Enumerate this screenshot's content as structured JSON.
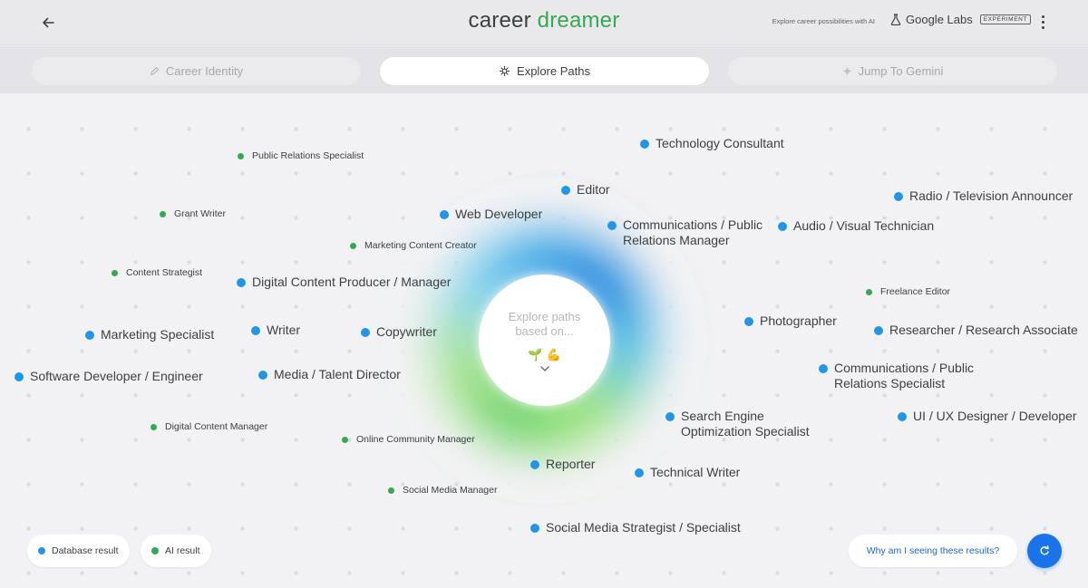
{
  "header": {
    "logo_part1": "career",
    "logo_part2": "dreamer",
    "tagline": "Explore career possibilities with AI",
    "labs_label": "Google Labs",
    "labs_badge": "EXPERIMENT",
    "icons": [
      "back-arrow-icon",
      "flask-icon",
      "more-vert-icon"
    ]
  },
  "tabs": [
    {
      "label": "Career Identity",
      "icon": "pencil-icon",
      "active": false
    },
    {
      "label": "Explore Paths",
      "icon": "sparkle-icon",
      "active": true
    },
    {
      "label": "Jump To Gemini",
      "icon": "gemini-spark-icon",
      "active": false
    }
  ],
  "center": {
    "prompt": "Explore paths based on...",
    "emojis": [
      "🌱",
      "💪"
    ],
    "icon": "chevron-down-icon"
  },
  "paths": {
    "database": [
      "Technology Consultant",
      "Editor",
      "Radio / Television Announcer",
      "Web Developer",
      "Communications / Public Relations Manager",
      "Audio / Visual Technician",
      "Digital Content Producer / Manager",
      "Photographer",
      "Researcher / Research Associate",
      "Marketing Specialist",
      "Writer",
      "Copywriter",
      "Software Developer / Engineer",
      "Media / Talent Director",
      "Communications / Public Relations Specialist",
      "Search Engine Optimization Specialist",
      "UI / UX Designer / Developer",
      "Reporter",
      "Technical Writer",
      "Social Media Strategist / Specialist"
    ],
    "ai": [
      "Public Relations Specialist",
      "Grant Writer",
      "Marketing Content Creator",
      "Content Strategist",
      "Freelance Editor",
      "Digital Content Manager",
      "Online Community Manager",
      "Social Media Manager"
    ]
  },
  "legend": {
    "database_label": "Database result",
    "ai_label": "AI result",
    "database_color": "#2196e8",
    "ai_color": "#34a853"
  },
  "why_button": "Why am I seeing these results?",
  "refresh_icon": "refresh-icon",
  "colors": {
    "accent_blue": "#1a73e8",
    "accent_green": "#34a853"
  }
}
